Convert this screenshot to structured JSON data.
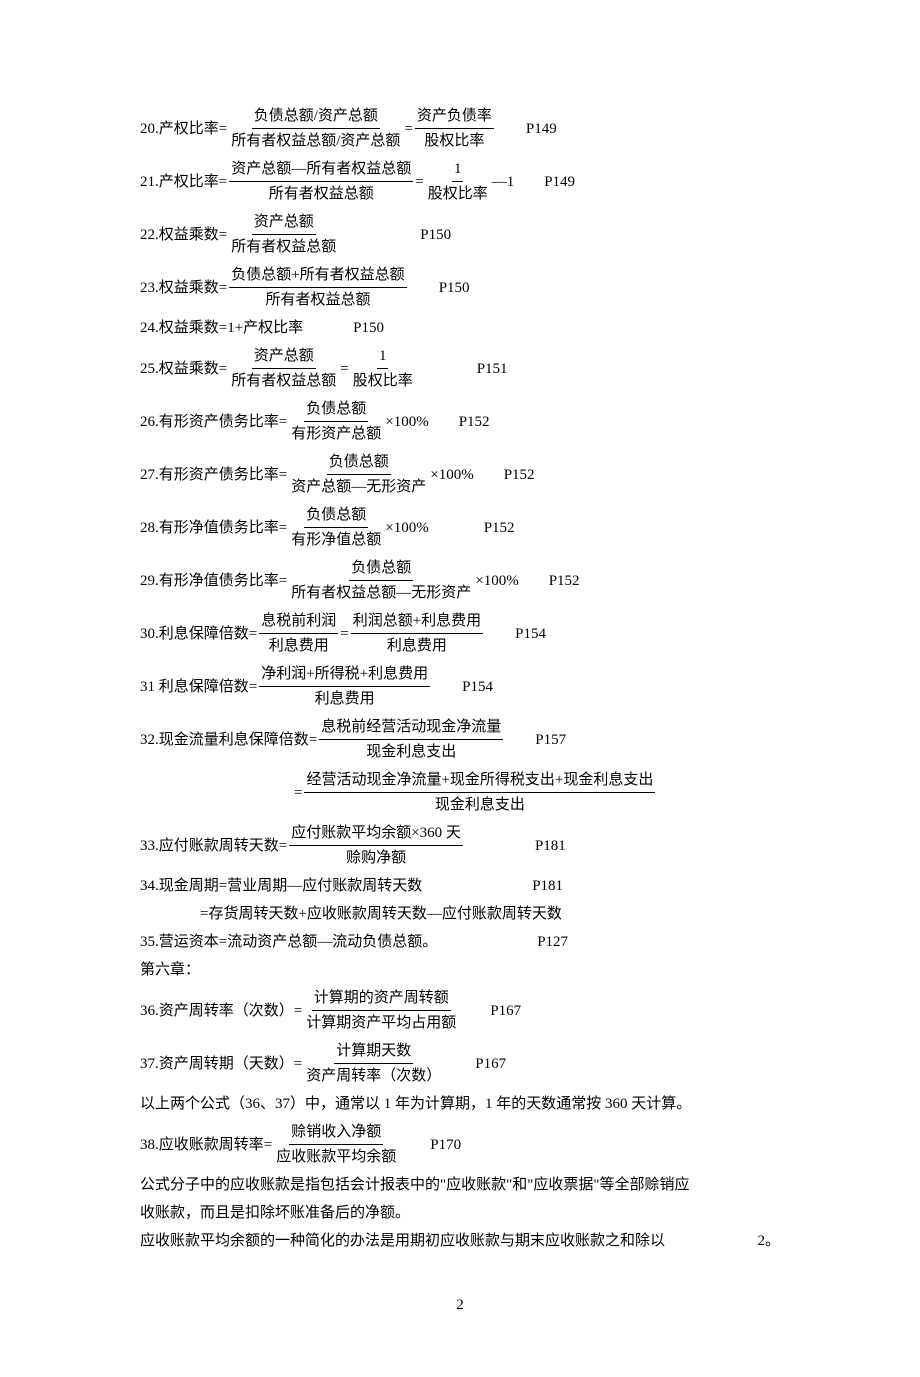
{
  "f20": {
    "lbl": "20.产权比率=",
    "n1": "负债总额/资产总额",
    "d1": "所有者权益总额/资产总额",
    "eq": " =",
    "n2": "资产负债率",
    "d2": "股权比率",
    "p": "P149"
  },
  "f21": {
    "lbl": "21.产权比率=",
    "n1": "资产总额—所有者权益总额",
    "d1": "所有者权益总额",
    "eq": " =",
    "n2": "1",
    "d2": "股权比率",
    "tail": " —1",
    "p": "P149"
  },
  "f22": {
    "lbl": "22.权益乘数=",
    "n1": "资产总额",
    "d1": "所有者权益总额",
    "p": "P150"
  },
  "f23": {
    "lbl": "23.权益乘数=",
    "n1": "负债总额+所有者权益总额",
    "d1": "所有者权益总额",
    "p": "P150"
  },
  "f24": {
    "lbl": "24.权益乘数=1+产权比率",
    "p": "P150"
  },
  "f25": {
    "lbl": "25.权益乘数=",
    "n1": "资产总额",
    "d1": "所有者权益总额",
    "eq": " =",
    "n2": "1",
    "d2": "股权比率",
    "p": "P151"
  },
  "f26": {
    "lbl": "26.有形资产债务比率=",
    "n1": "负债总额",
    "d1": "有形资产总额",
    "tail": " ×100%",
    "p": "P152"
  },
  "f27": {
    "lbl": "27.有形资产债务比率=",
    "n1": "负债总额",
    "d1": "资产总额—无形资产",
    "tail": " ×100%",
    "p": "P152"
  },
  "f28": {
    "lbl": "28.有形净值债务比率=",
    "n1": "负债总额",
    "d1": "有形净值总额",
    "tail": "  ×100%",
    "p": "P152"
  },
  "f29": {
    "lbl": "29.有形净值债务比率=",
    "n1": "负债总额",
    "d1": "所有者权益总额—无形资产",
    "tail": " ×100%",
    "p": "P152"
  },
  "f30": {
    "lbl": "30.利息保障倍数=",
    "n1": "息税前利润",
    "d1": "利息费用",
    "eq": " =",
    "n2": "利润总额+利息费用",
    "d2": "利息费用",
    "p": "P154"
  },
  "f31": {
    "lbl": "31 利息保障倍数=",
    "n1": "净利润+所得税+利息费用",
    "d1": "利息费用",
    "p": "P154"
  },
  "f32": {
    "lbl": "32.现金流量利息保障倍数=",
    "n1": "息税前经营活动现金净流量",
    "d1": "现金利息支出",
    "p": "P157"
  },
  "f32b": {
    "eq": "=",
    "n1": "经营活动现金净流量+现金所得税支出+现金利息支出",
    "d1": "现金利息支出"
  },
  "f33": {
    "lbl": "33.应付账款周转天数=",
    "n1": "应付账款平均余额×360 天",
    "d1": "赊购净额",
    "p": "P181"
  },
  "f34a": {
    "txt": "34.现金周期=营业周期—应付账款周转天数",
    "p": "P181"
  },
  "f34b": {
    "txt": "=存货周转天数+应收账款周转天数—应付账款周转天数"
  },
  "f35": {
    "txt": "35.营运资本=流动资产总额—流动负债总额。",
    "p": "P127"
  },
  "chapter6": {
    "txt": "第六章："
  },
  "f36": {
    "lbl": "36.资产周转率（次数）=",
    "n1": "计算期的资产周转额",
    "d1": "计算期资产平均占用额",
    "p": "P167"
  },
  "f37": {
    "lbl": "37.资产周转期（天数）=",
    "n1": "计算期天数",
    "d1": "资产周转率（次数）",
    "p": "P167"
  },
  "note37": {
    "txt": "以上两个公式（36、37）中，通常以 1 年为计算期，1 年的天数通常按 360 天计算。"
  },
  "f38": {
    "lbl": "38.应收账款周转率=",
    "n1": "赊销收入净额",
    "d1": "应收账款平均余额",
    "p": "P170"
  },
  "note38a": {
    "txt": "公式分子中的应收账款是指包括会计报表中的\"应收账款\"和\"应收票据\"等全部赊销应"
  },
  "note38b": {
    "txt": "收账款，而且是扣除坏账准备后的净额。"
  },
  "note38c": {
    "txt": "应收账款平均余额的一种简化的办法是用期初应收账款与期末应收账款之和除以",
    "tail": "2。"
  },
  "pagenum": "2"
}
